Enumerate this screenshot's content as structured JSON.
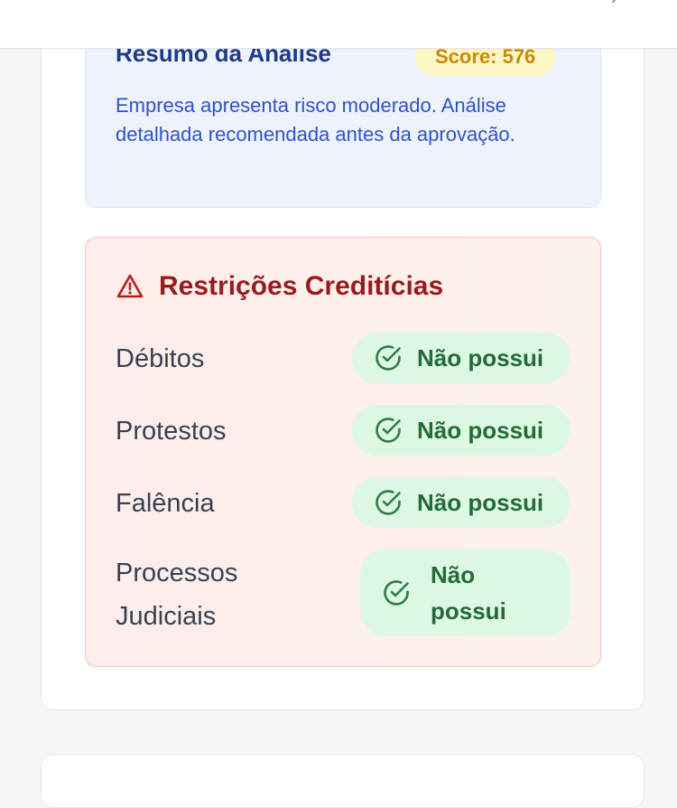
{
  "summary": {
    "title": "Resumo da Análise",
    "score_label": "Score: 576",
    "description": "Empresa apresenta risco moderado. Análise detalhada recomendada antes da aprovação."
  },
  "restrictions": {
    "title": "Restrições Creditícias",
    "icon": "warning-triangle-icon",
    "items": [
      {
        "label": "Débitos",
        "status": "Não possui",
        "icon": "check-circle-icon"
      },
      {
        "label": "Protestos",
        "status": "Não possui",
        "icon": "check-circle-icon"
      },
      {
        "label": "Falência",
        "status": "Não possui",
        "icon": "check-circle-icon"
      },
      {
        "label": "Processos Judiciais",
        "status": "Não possui",
        "icon": "check-circle-icon"
      }
    ]
  },
  "colors": {
    "summary_bg": "#eef2fd",
    "summary_text": "#1e3a8a",
    "score_badge_bg": "#fdf6c5",
    "score_badge_text": "#ca8a04",
    "restriction_title": "#991b1b",
    "status_pill_bg": "#dcf7e2",
    "status_pill_text": "#256b3a"
  }
}
